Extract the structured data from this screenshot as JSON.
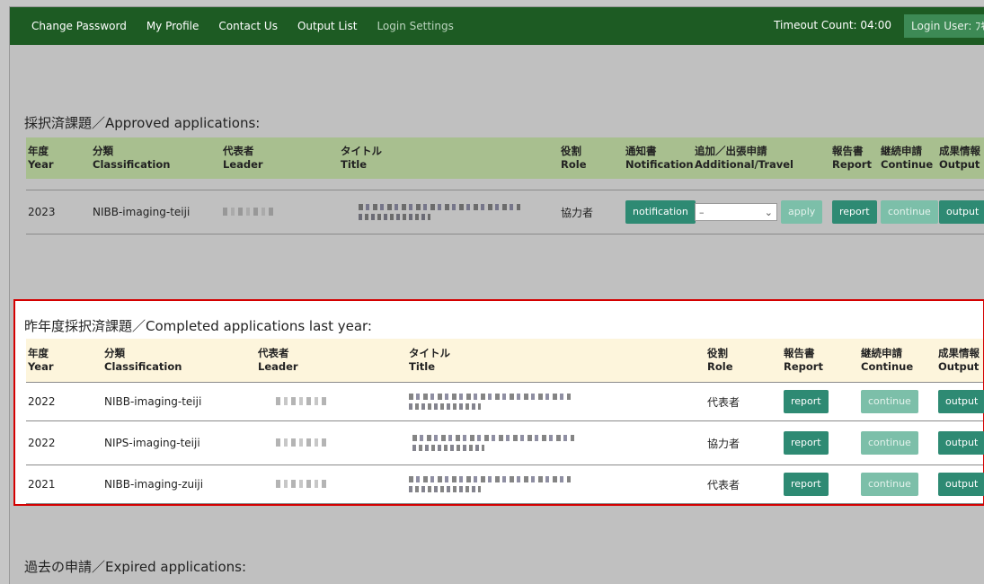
{
  "nav": {
    "items": [
      "Change Password",
      "My Profile",
      "Contact Us",
      "Output List",
      "Login Settings"
    ],
    "timeout": "Timeout Count: 04:00",
    "login_user": "Login User: ﾌｷ"
  },
  "approved": {
    "title": "採択済課題／Approved applications:",
    "headers": {
      "year": [
        "年度",
        "Year"
      ],
      "classification": [
        "分類",
        "Classification"
      ],
      "leader": [
        "代表者",
        "Leader"
      ],
      "title": [
        "タイトル",
        "Title"
      ],
      "role": [
        "役割",
        "Role"
      ],
      "notification": [
        "通知書",
        "Notification"
      ],
      "additional": [
        "追加／出張申請",
        "Additional/Travel"
      ],
      "report": [
        "報告書",
        "Report"
      ],
      "continue": [
        "継続申請",
        "Continue"
      ],
      "output": [
        "成果情報",
        "Output"
      ]
    },
    "rows": [
      {
        "year": "2023",
        "classification": "NIBB-imaging-teiji",
        "role": "協力者",
        "notification": "notification",
        "select_value": "–",
        "apply": "apply",
        "report": "report",
        "continue": "continue",
        "output": "output"
      }
    ]
  },
  "completed": {
    "title": "昨年度採択済課題／Completed applications last year:",
    "headers": {
      "year": [
        "年度",
        "Year"
      ],
      "classification": [
        "分類",
        "Classification"
      ],
      "leader": [
        "代表者",
        "Leader"
      ],
      "title": [
        "タイトル",
        "Title"
      ],
      "role": [
        "役割",
        "Role"
      ],
      "report": [
        "報告書",
        "Report"
      ],
      "continue": [
        "継続申請",
        "Continue"
      ],
      "output": [
        "成果情報",
        "Output"
      ]
    },
    "rows": [
      {
        "year": "2022",
        "classification": "NIBB-imaging-teiji",
        "role": "代表者",
        "report": "report",
        "continue": "continue",
        "output": "output"
      },
      {
        "year": "2022",
        "classification": "NIPS-imaging-teiji",
        "role": "協力者",
        "report": "report",
        "continue": "continue",
        "output": "output"
      },
      {
        "year": "2021",
        "classification": "NIBB-imaging-zuiji",
        "role": "代表者",
        "report": "report",
        "continue": "continue",
        "output": "output"
      }
    ]
  },
  "expired": {
    "title": "過去の申請／Expired applications:"
  },
  "colors": {
    "topbar": "#1d5b23",
    "header_green": "#a8bf8f",
    "header_cream": "#fdf5dc",
    "button": "#2e8a73",
    "button_disabled": "#7cbfa9",
    "highlight_border": "#d40000"
  }
}
